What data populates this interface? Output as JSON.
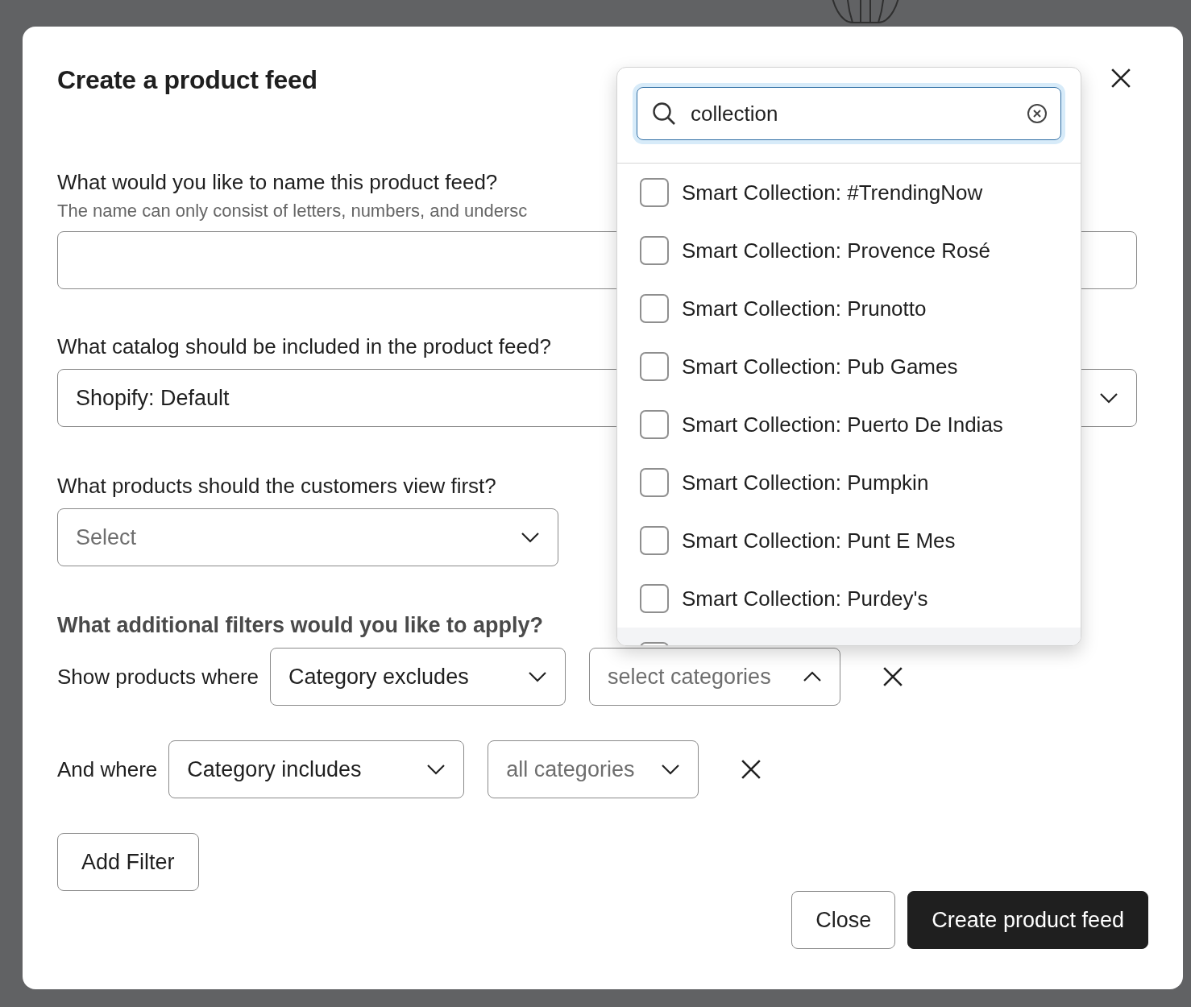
{
  "dialog": {
    "title": "Create a product feed",
    "name_field": {
      "label": "What would you like to name this product feed?",
      "hint": "The name can only consist of letters, numbers, and undersc"
    },
    "catalog_field": {
      "label": "What catalog should be included in the product feed?",
      "value": "Shopify: Default"
    },
    "first_view_field": {
      "label": "What products should the customers view first?",
      "placeholder": "Select"
    },
    "filters": {
      "heading": "What additional filters would you like to apply?",
      "rows": [
        {
          "prefix": "Show products where",
          "condition": "Category excludes",
          "value_placeholder": "select categories",
          "expanded": true
        },
        {
          "prefix": "And where",
          "condition": "Category includes",
          "value_placeholder": "all categories",
          "expanded": false
        }
      ],
      "add_button": "Add Filter"
    },
    "buttons": [
      {
        "label": "Close",
        "kind": "secondary"
      },
      {
        "label": "Create product feed",
        "kind": "primary"
      }
    ]
  },
  "category_dropdown": {
    "search_value": "collection",
    "options": [
      {
        "label": "Smart Collection: #TrendingNow",
        "checked": false,
        "hovered": false
      },
      {
        "label": "Smart Collection: Provence Rosé",
        "checked": false,
        "hovered": false
      },
      {
        "label": "Smart Collection: Prunotto",
        "checked": false,
        "hovered": false
      },
      {
        "label": "Smart Collection: Pub Games",
        "checked": false,
        "hovered": false
      },
      {
        "label": "Smart Collection: Puerto De Indias",
        "checked": false,
        "hovered": false
      },
      {
        "label": "Smart Collection: Pumpkin",
        "checked": false,
        "hovered": false
      },
      {
        "label": "Smart Collection: Punt E Mes",
        "checked": false,
        "hovered": false
      },
      {
        "label": "Smart Collection: Purdey's",
        "checked": false,
        "hovered": false
      },
      {
        "checked": false,
        "hovered": true
      }
    ]
  }
}
